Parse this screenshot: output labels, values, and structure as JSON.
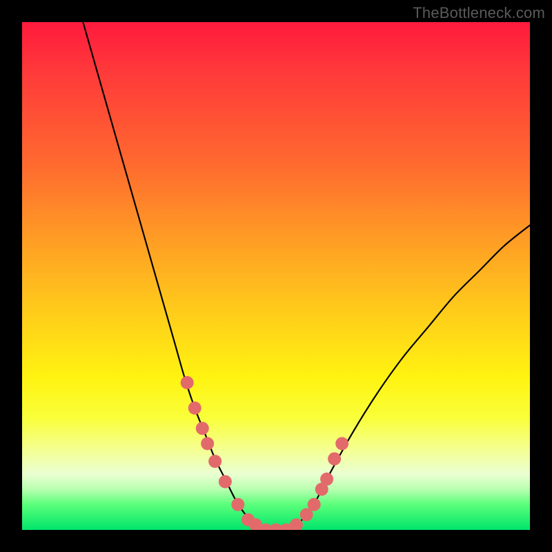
{
  "watermark": "TheBottleneck.com",
  "chart_data": {
    "type": "line",
    "title": "",
    "xlabel": "",
    "ylabel": "",
    "xlim": [
      0,
      100
    ],
    "ylim": [
      0,
      100
    ],
    "series": [
      {
        "name": "bottleneck-curve",
        "x": [
          12,
          14,
          16,
          18,
          20,
          22,
          24,
          26,
          28,
          30,
          32,
          34,
          36,
          38,
          40,
          42,
          44,
          46,
          48,
          50,
          52,
          54,
          56,
          58,
          60,
          65,
          70,
          75,
          80,
          85,
          90,
          95,
          100
        ],
        "y": [
          100,
          93,
          86,
          79,
          72,
          65,
          58,
          51,
          44,
          37,
          30,
          24,
          19,
          14,
          10,
          6,
          3,
          1,
          0,
          0,
          0,
          1,
          3,
          6,
          10,
          19,
          27,
          34,
          40,
          46,
          51,
          56,
          60
        ]
      }
    ],
    "markers": {
      "name": "highlight-dots",
      "color": "#e36a6a",
      "points_x": [
        32.5,
        34.0,
        35.5,
        36.5,
        38.0,
        40.0,
        42.5,
        44.5,
        46.0,
        48.0,
        50.0,
        52.0,
        54.0,
        56.0,
        57.5,
        59.0,
        60.0,
        61.5,
        63.0
      ],
      "points_y": [
        29.0,
        24.0,
        20.0,
        17.0,
        13.5,
        9.5,
        5.0,
        2.0,
        1.0,
        0.0,
        0.0,
        0.0,
        1.0,
        3.0,
        5.0,
        8.0,
        10.0,
        14.0,
        17.0
      ]
    },
    "gradient_stops": [
      {
        "pos": 0,
        "color": "#ff1a3d"
      },
      {
        "pos": 0.7,
        "color": "#fff311"
      },
      {
        "pos": 1.0,
        "color": "#00e56b"
      }
    ]
  }
}
